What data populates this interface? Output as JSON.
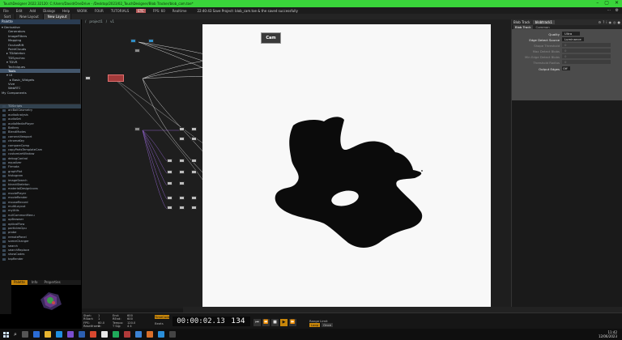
{
  "titlebar": {
    "text": "TouchDesigner 2022.32120: C:/Users/David/OneDrive - /Desktop/2023/02_TouchDesigner/Blob Tracker/blob_cam.toe*"
  },
  "menubar": {
    "items": [
      "File",
      "Edit",
      "Add",
      "Dialogs",
      "Help",
      "WORK",
      "FOUR",
      "TUTORIALS"
    ],
    "highlight": "ETC",
    "fps": "FPS: 60",
    "mode": "Realtime",
    "message": "22:40:43 Save Project: blob_cam.toe & the saved successfully"
  },
  "tabs": [
    "Sort",
    "New Layout",
    "New Layout"
  ],
  "palette": {
    "header": "Palette",
    "tree": [
      {
        "label": "▾ Derivative",
        "indent": 2
      },
      {
        "label": "Generators",
        "indent": 10
      },
      {
        "label": "ImageFilters",
        "indent": 10
      },
      {
        "label": "Mapping",
        "indent": 10
      },
      {
        "label": "OculusRift",
        "indent": 10
      },
      {
        "label": "PointClouds",
        "indent": 10
      },
      {
        "label": "▸ TDAbleton",
        "indent": 8
      },
      {
        "label": "TDSynchro",
        "indent": 10
      },
      {
        "label": "▾ TDVR",
        "indent": 8
      },
      {
        "label": "Techniques",
        "indent": 10
      },
      {
        "label": "Tools",
        "indent": 10,
        "selected": true
      },
      {
        "label": "▾ UI",
        "indent": 8
      },
      {
        "label": "▸ Basic_Widgets",
        "indent": 12
      },
      {
        "label": "Vive",
        "indent": 10
      },
      {
        "label": "WebRTC",
        "indent": 10
      },
      {
        "label": "My Components",
        "indent": 2
      }
    ],
    "list": [
      "TDScripts",
      "arcBallGeometry",
      "audioAnalysis",
      "audioSet",
      "audioMediaPlayer",
      "Battery",
      "BlendModes",
      "cameraViewport",
      "chromaKey",
      "compareComp",
      "copyPartsTemplateCam",
      "customizeWindow",
      "debugControl",
      "equalizer",
      "Firmata",
      "graphPlot",
      "histogram",
      "imageSearch",
      "kinectSkeleton",
      "materialDesignIcons",
      "moviePlayer",
      "movieRender",
      "mouseRecord",
      "multiLayout",
      "myUtils",
      "nullCommonMenu",
      "opBrowser",
      "opticalFlow",
      "particlesGpu",
      "probe",
      "remotePanel",
      "sceneChanger",
      "search",
      "searchReplace",
      "showCodes",
      "tapRender"
    ],
    "list_selected": 0
  },
  "preview": {
    "tabs": [
      "Palette",
      "Info",
      "Properties"
    ],
    "active": 0
  },
  "network": {
    "path": [
      "/",
      "project1",
      "/",
      "v1"
    ]
  },
  "overlay": {
    "cam_label": "Cam"
  },
  "params": {
    "title": "Blob Track",
    "name": "blobtrack1",
    "icons": [
      "⚙",
      "?",
      "i",
      "◉",
      "◎",
      "●"
    ],
    "tabs": [
      "Blob Track",
      "Common"
    ],
    "rows": [
      {
        "label": "Quality",
        "value": "Ultra",
        "dim": false
      },
      {
        "label": "Edge Detect Source",
        "value": "Luminance",
        "dim": false
      },
      {
        "label": "Shape Threshold",
        "value": "0",
        "dim": true
      },
      {
        "label": "Max Detect Blobs",
        "value": "0",
        "dim": true
      },
      {
        "label": "Min Edge Detect Blobs",
        "value": "0",
        "dim": true
      },
      {
        "label": "Threshold Radius",
        "value": "0",
        "dim": true
      },
      {
        "label": "Output Edges",
        "value": "Off",
        "dim": false
      }
    ]
  },
  "timeline": {
    "stats": [
      "Start:",
      "1",
      "End:",
      "600",
      "RStart:",
      "1",
      "REnd:",
      "600",
      "FPS:",
      "60.0",
      "Tempo:",
      "120.0",
      "Resetframe:",
      "0",
      "T Sig:",
      "4 4"
    ],
    "timecode_label": "TimeCode",
    "beats_label": "Beats",
    "timecode": "00:00:02.13",
    "frame": "134",
    "controls": [
      "⏮",
      "⏪",
      "■",
      "▶",
      "⏩"
    ],
    "range_label": "Range Limit",
    "range_a": "Loop",
    "range_b": "Once"
  },
  "taskbar": {
    "time": "11:42",
    "date": "12/06/2023"
  }
}
